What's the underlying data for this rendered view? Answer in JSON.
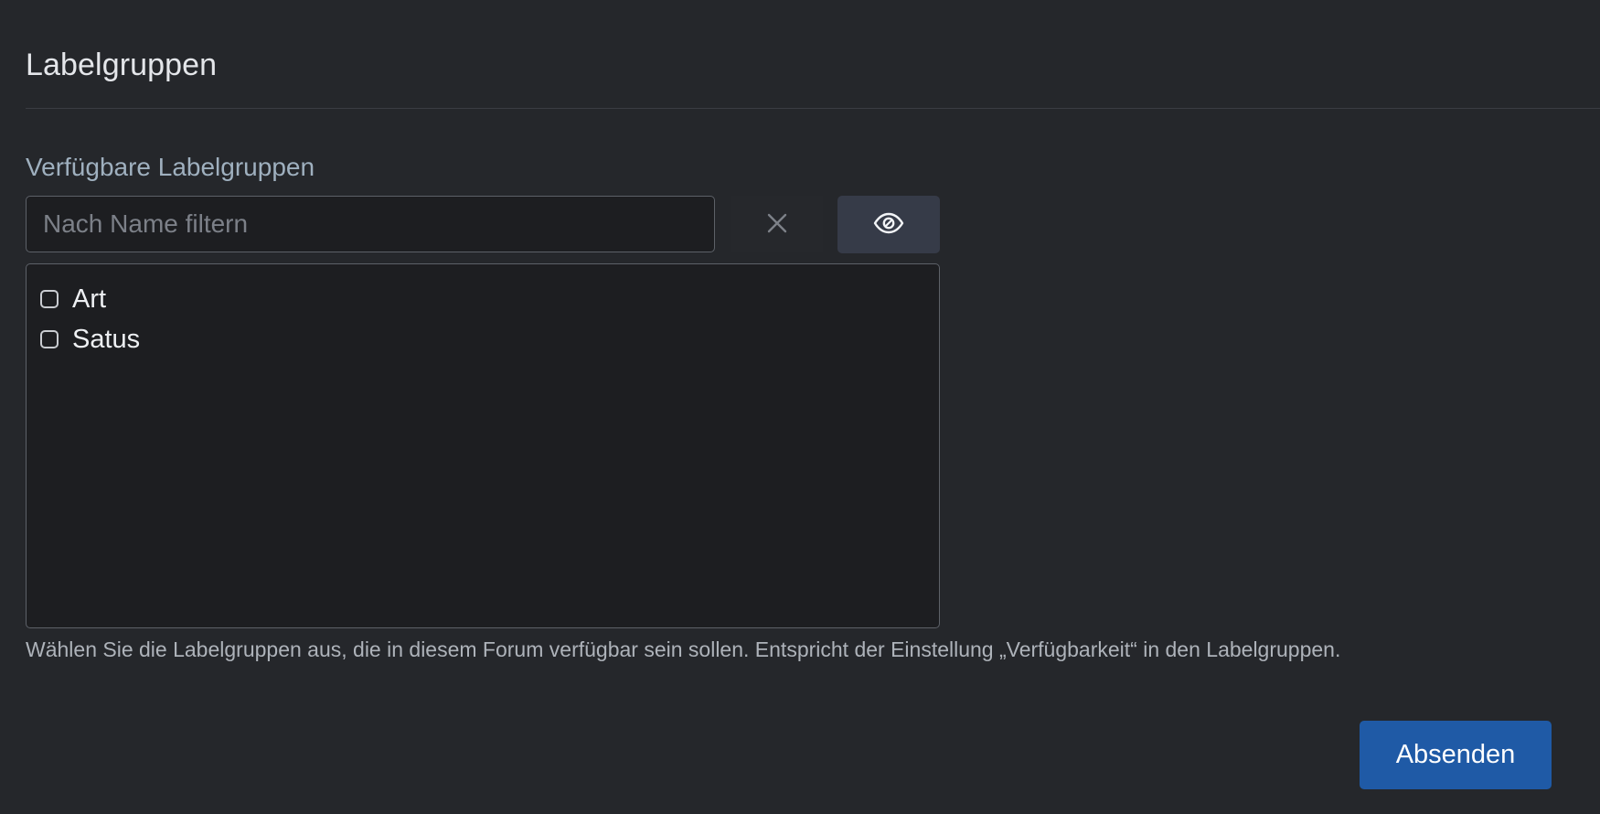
{
  "section": {
    "title": "Labelgruppen"
  },
  "field": {
    "label": "Verfügbare Labelgruppen",
    "filter_placeholder": "Nach Name filtern",
    "filter_value": "",
    "clear_icon": "close-icon",
    "toggle_icon": "eye-icon"
  },
  "list": {
    "items": [
      {
        "label": "Art",
        "checked": false
      },
      {
        "label": "Satus",
        "checked": false
      }
    ]
  },
  "help_text": "Wählen Sie die Labelgruppen aus, die in diesem Forum verfügbar sein sollen. Entspricht der Einstellung „Verfügbarkeit“ in den Labelgruppen.",
  "actions": {
    "submit_label": "Absenden"
  },
  "colors": {
    "background": "#25272b",
    "input_background": "#1d1e21",
    "label_color": "#9fb0bf",
    "primary_button": "#1f5aa6",
    "secondary_button": "#363b48"
  }
}
